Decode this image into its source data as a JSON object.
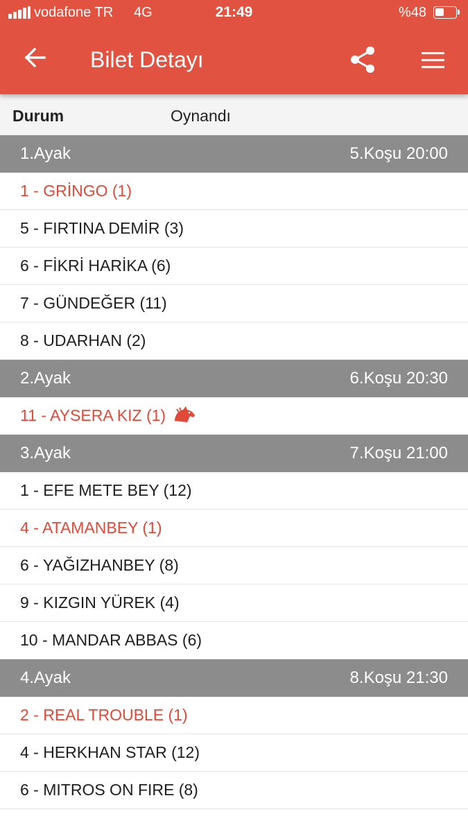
{
  "status_bar": {
    "carrier": "vodafone TR",
    "network": "4G",
    "time": "21:49",
    "battery": "%48",
    "battery_level": 0.48
  },
  "app_bar": {
    "title": "Bilet Detayı",
    "back_icon": "arrow-left-icon",
    "share_icon": "share-icon",
    "menu_icon": "hamburger-menu-icon"
  },
  "status_row": {
    "label": "Durum",
    "value": "Oynandı"
  },
  "colors": {
    "primary": "#e25241",
    "winner_text": "#e04a38",
    "leg_header_bg": "#8c8c8c"
  },
  "legs": [
    {
      "name": "1.Ayak",
      "race": "5.Koşu 20:00",
      "horses": [
        {
          "text": "1 - GRİNGO (1)",
          "winner": true
        },
        {
          "text": "5 - FIRTINA DEMİR (3)",
          "winner": false
        },
        {
          "text": "6 - FİKRİ HARİKA (6)",
          "winner": false
        },
        {
          "text": "7 - GÜNDEĞER (11)",
          "winner": false
        },
        {
          "text": "8 - UDARHAN (2)",
          "winner": false
        }
      ]
    },
    {
      "name": "2.Ayak",
      "race": "6.Koşu 20:30",
      "horses": [
        {
          "text": "11 - AYSERA KIZ (1)",
          "winner": true,
          "icon": "horse-head-icon"
        }
      ]
    },
    {
      "name": "3.Ayak",
      "race": "7.Koşu 21:00",
      "horses": [
        {
          "text": "1 - EFE METE BEY (12)",
          "winner": false
        },
        {
          "text": "4 - ATAMANBEY (1)",
          "winner": true
        },
        {
          "text": "6 - YAĞIZHANBEY (8)",
          "winner": false
        },
        {
          "text": "9 - KIZGIN YÜREK (4)",
          "winner": false
        },
        {
          "text": "10 - MANDAR ABBAS (6)",
          "winner": false
        }
      ]
    },
    {
      "name": "4.Ayak",
      "race": "8.Koşu 21:30",
      "horses": [
        {
          "text": "2 - REAL TROUBLE (1)",
          "winner": true
        },
        {
          "text": "4 - HERKHAN STAR (12)",
          "winner": false
        },
        {
          "text": "6 - MITROS ON FIRE (8)",
          "winner": false
        }
      ]
    }
  ]
}
